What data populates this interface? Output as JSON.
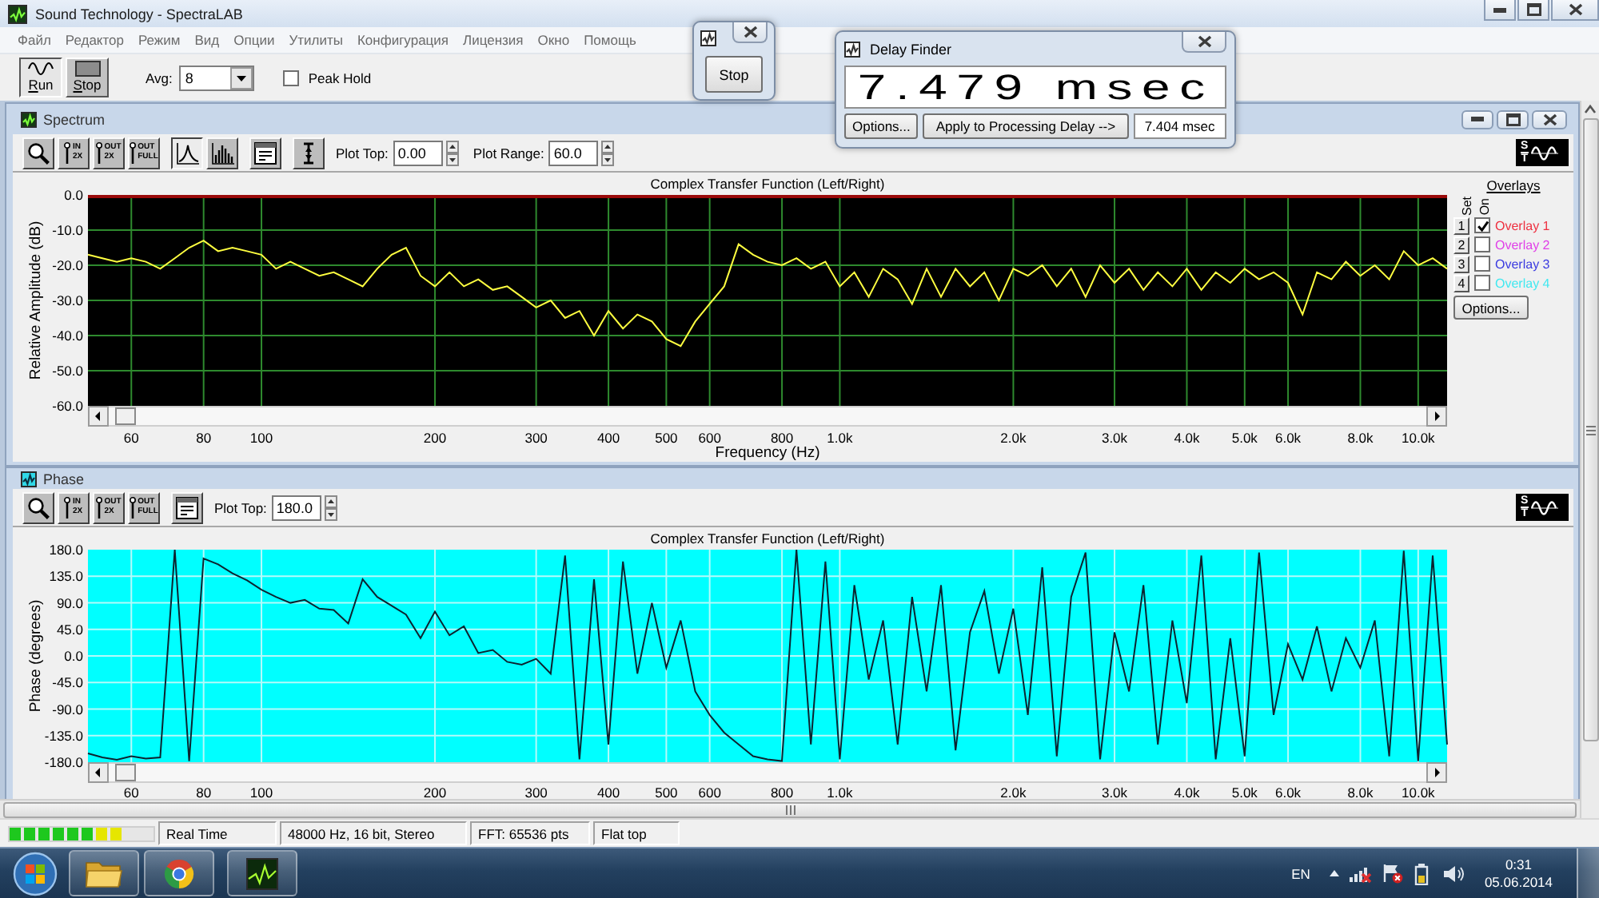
{
  "window": {
    "title": "Sound Technology - SpectraLAB"
  },
  "menu": [
    "Файл",
    "Редактор",
    "Режим",
    "Вид",
    "Опции",
    "Утилиты",
    "Конфигурация",
    "Лицензия",
    "Окно",
    "Помощь"
  ],
  "toolbar": {
    "buttons": [
      {
        "kind": "run",
        "label": "Run",
        "active": true
      },
      {
        "kind": "stop",
        "label": "Stop",
        "active": false
      }
    ],
    "avg": {
      "label": "Avg:",
      "value": "8"
    },
    "peak_hold": {
      "label": "Peak Hold",
      "checked": false
    }
  },
  "stop_window": {
    "button": "Stop"
  },
  "delay_finder": {
    "title": "Delay Finder",
    "reading": "7.479 msec",
    "buttons": [
      "Options...",
      "Apply to Processing Delay -->"
    ],
    "value": "7.404 msec"
  },
  "spectrum": {
    "title": "Spectrum",
    "tool_groups": [
      [
        {
          "kind": "zoom",
          "selected": false
        },
        {
          "kind": "zoom_in",
          "label": "IN 2X",
          "selected": false
        },
        {
          "kind": "zoom_out",
          "label": "OUT 2X",
          "selected": false
        },
        {
          "kind": "zoom_full",
          "label": "OUT FULL",
          "selected": false
        }
      ],
      [
        {
          "kind": "line",
          "selected": true
        },
        {
          "kind": "bars",
          "selected": false
        }
      ],
      [
        {
          "kind": "form",
          "selected": false
        }
      ],
      [
        {
          "kind": "cursor",
          "selected": false
        }
      ]
    ],
    "plot_top": {
      "label": "Plot Top:",
      "value": "0.00"
    },
    "plot_range": {
      "label": "Plot Range:",
      "value": "60.0"
    },
    "logo": [
      "S",
      "T"
    ],
    "chart_data": {
      "type": "line",
      "title": "Complex Transfer Function (Left/Right)",
      "xlabel": "Frequency (Hz)",
      "ylabel": "Relative Amplitude (dB)",
      "grid": true,
      "categories": [
        null,
        null,
        null,
        "60",
        null,
        null,
        null,
        null,
        "80",
        null,
        null,
        null,
        "100",
        null,
        null,
        null,
        null,
        null,
        null,
        null,
        null,
        null,
        null,
        null,
        "200",
        null,
        null,
        null,
        null,
        null,
        null,
        "300",
        null,
        null,
        null,
        null,
        "400",
        null,
        null,
        null,
        "500",
        null,
        null,
        "600",
        null,
        null,
        null,
        null,
        "800",
        null,
        null,
        null,
        "1.0k",
        null,
        null,
        null,
        null,
        null,
        null,
        null,
        null,
        null,
        null,
        null,
        "2.0k",
        null,
        null,
        null,
        null,
        null,
        null,
        "3.0k",
        null,
        null,
        null,
        null,
        "4.0k",
        null,
        null,
        null,
        "5.0k",
        null,
        null,
        "6.0k",
        null,
        null,
        null,
        null,
        "8.0k",
        null,
        null,
        null,
        "10.0k",
        null,
        null
      ],
      "series": [
        {
          "color": "#ffff40",
          "values": [
            -17,
            -18,
            -19,
            -18,
            -19,
            -21,
            -18,
            -15,
            -13,
            -16,
            -15,
            -16,
            -17,
            -21,
            -19,
            -21,
            -23,
            -22,
            -24,
            -26,
            -21,
            -17,
            -15,
            -23,
            -26,
            -22,
            -26,
            -24,
            -27,
            -26,
            -29,
            -32,
            -30,
            -35,
            -33,
            -40,
            -33,
            -38,
            -34,
            -36,
            -41,
            -43,
            -36,
            -31,
            -26,
            -14,
            -17,
            -19,
            -20,
            -18,
            -21,
            -19,
            -26,
            -22,
            -29,
            -21,
            -24,
            -31,
            -21,
            -29,
            -21,
            -26,
            -22,
            -30,
            -21,
            -23,
            -20,
            -26,
            -21,
            -29,
            -20,
            -25,
            -21,
            -27,
            -22,
            -26,
            -21,
            -27,
            -22,
            -25,
            -21,
            -24,
            -22,
            -25,
            -34,
            -22,
            -24,
            -19,
            -23,
            -20,
            -24,
            -16,
            -20,
            -18,
            -21
          ]
        }
      ],
      "ylim": [
        -60,
        0
      ],
      "yticks": [
        {
          "value": 0,
          "label": "0.0"
        },
        {
          "value": -10,
          "label": "-10.0"
        },
        {
          "value": -20,
          "label": "-20.0"
        },
        {
          "value": -30,
          "label": "-30.0"
        },
        {
          "value": -40,
          "label": "-40.0"
        },
        {
          "value": -50,
          "label": "-50.0"
        },
        {
          "value": -60,
          "label": "-60.0"
        }
      ]
    },
    "overlays": {
      "title": "Overlays",
      "set_label": "Set",
      "on_label": "On",
      "items": [
        {
          "set": "1",
          "label": "Overlay 1",
          "checked": true,
          "color": "#ee3040"
        },
        {
          "set": "2",
          "label": "Overlay 2",
          "checked": false,
          "color": "#e040e8"
        },
        {
          "set": "3",
          "label": "Overlay 3",
          "checked": false,
          "color": "#3a3ae0"
        },
        {
          "set": "4",
          "label": "Overlay 4",
          "checked": false,
          "color": "#40e8f0"
        }
      ],
      "button": "Options..."
    }
  },
  "phase": {
    "title": "Phase",
    "tool_groups": [
      [
        {
          "kind": "zoom",
          "selected": false
        },
        {
          "kind": "zoom_in",
          "label": "IN 2X",
          "selected": false
        },
        {
          "kind": "zoom_out",
          "label": "OUT 2X",
          "selected": false
        },
        {
          "kind": "zoom_full",
          "label": "OUT FULL",
          "selected": false
        }
      ],
      [
        {
          "kind": "form",
          "selected": false
        }
      ]
    ],
    "plot_top": {
      "label": "Plot Top:",
      "value": "180.0"
    },
    "logo": [
      "S",
      "T"
    ],
    "chart_data": {
      "type": "line",
      "title": "Complex Transfer Function (Left/Right)",
      "ylabel": "Phase (degrees)",
      "grid": true,
      "categories": [
        null,
        null,
        null,
        "60",
        null,
        null,
        null,
        null,
        "80",
        null,
        null,
        null,
        "100",
        null,
        null,
        null,
        null,
        null,
        null,
        null,
        null,
        null,
        null,
        null,
        "200",
        null,
        null,
        null,
        null,
        null,
        null,
        "300",
        null,
        null,
        null,
        null,
        "400",
        null,
        null,
        null,
        "500",
        null,
        null,
        "600",
        null,
        null,
        null,
        null,
        "800",
        null,
        null,
        null,
        "1.0k",
        null,
        null,
        null,
        null,
        null,
        null,
        null,
        null,
        null,
        null,
        null,
        "2.0k",
        null,
        null,
        null,
        null,
        null,
        null,
        "3.0k",
        null,
        null,
        null,
        null,
        "4.0k",
        null,
        null,
        null,
        "5.0k",
        null,
        null,
        "6.0k",
        null,
        null,
        null,
        null,
        "8.0k",
        null,
        null,
        null,
        "10.0k",
        null,
        null
      ],
      "series": [
        {
          "color": "#0c2430",
          "values": [
            -165,
            -172,
            -176,
            -170,
            -174,
            -172,
            180,
            -178,
            165,
            155,
            140,
            128,
            112,
            100,
            90,
            95,
            80,
            78,
            55,
            130,
            100,
            85,
            70,
            30,
            75,
            35,
            50,
            5,
            10,
            -10,
            -15,
            -5,
            -30,
            170,
            -175,
            130,
            -150,
            160,
            -30,
            90,
            -20,
            60,
            -60,
            -100,
            -130,
            -150,
            -170,
            -175,
            -178,
            180,
            -150,
            160,
            -175,
            120,
            -40,
            60,
            -150,
            100,
            -60,
            120,
            -160,
            40,
            110,
            -30,
            80,
            -100,
            150,
            -170,
            100,
            175,
            -175,
            40,
            -60,
            120,
            -150,
            60,
            -80,
            170,
            -175,
            30,
            -170,
            175,
            -100,
            20,
            -40,
            50,
            -60,
            30,
            -20,
            60,
            -170,
            178,
            -178,
            170,
            -150
          ]
        }
      ],
      "ylim": [
        -180,
        180
      ],
      "yticks": [
        {
          "value": 180,
          "label": "180.0"
        },
        {
          "value": 135,
          "label": "135.0"
        },
        {
          "value": 90,
          "label": "90.0"
        },
        {
          "value": 45,
          "label": "45.0"
        },
        {
          "value": 0,
          "label": "0.0"
        },
        {
          "value": -45,
          "label": "-45.0"
        },
        {
          "value": -90,
          "label": "-90.0"
        },
        {
          "value": -135,
          "label": "-135.0"
        },
        {
          "value": -180,
          "label": "-180.0"
        }
      ]
    }
  },
  "status_bar": {
    "meter": {
      "level": 0.8
    },
    "cells": [
      "Real Time",
      "48000 Hz, 16 bit, Stereo",
      "FFT: 65536 pts",
      "Flat top"
    ]
  },
  "taskbar": {
    "apps": [
      {
        "kind": "folder"
      },
      {
        "kind": "browser"
      },
      {
        "kind": "analyzer"
      }
    ],
    "language": "EN",
    "time": "0:31",
    "date": "05.06.2014"
  }
}
